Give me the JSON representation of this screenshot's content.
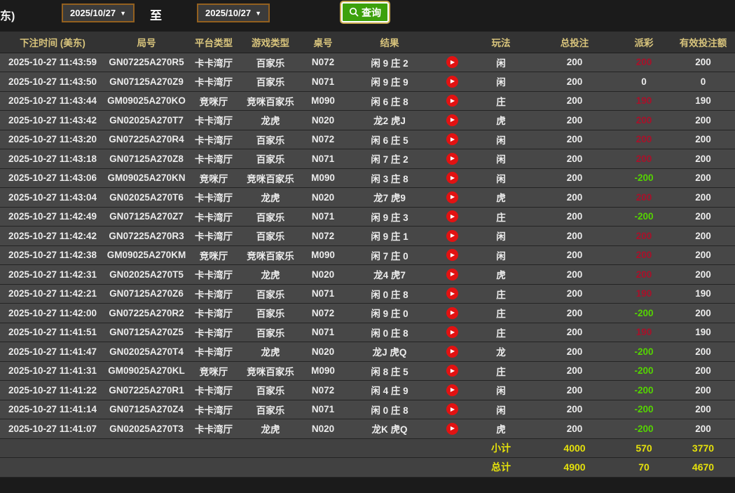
{
  "topbar": {
    "clipped_label": "东)",
    "date_from": "2025/10/27",
    "to_label": "至",
    "date_to": "2025/10/27",
    "query_label": "查询"
  },
  "icons": {
    "caret": "▼",
    "play": "▶"
  },
  "colors": {
    "header_text": "#d8c47c",
    "payout_win": "#a8112a",
    "payout_loss": "#55d400",
    "summary_text": "#e5e10b",
    "query_button_bg": "#3da10c",
    "date_border": "#93601f",
    "play_icon_bg": "#e21212"
  },
  "table": {
    "columns": [
      "下注时间 (美东)",
      "局号",
      "平台类型",
      "游戏类型",
      "桌号",
      "结果",
      "",
      "玩法",
      "总投注",
      "派彩",
      "有效投注额"
    ],
    "rows": [
      {
        "time": "2025-10-27 11:43:59",
        "round": "GN07225A270R5",
        "platform": "卡卡湾厅",
        "game": "百家乐",
        "table_no": "N072",
        "result": "闲 9 庄 2",
        "bet_type": "闲",
        "total_bet": "200",
        "payout": "200",
        "valid_bet": "200"
      },
      {
        "time": "2025-10-27 11:43:50",
        "round": "GN07125A270Z9",
        "platform": "卡卡湾厅",
        "game": "百家乐",
        "table_no": "N071",
        "result": "闲 9 庄 9",
        "bet_type": "闲",
        "total_bet": "200",
        "payout": "0",
        "valid_bet": "0"
      },
      {
        "time": "2025-10-27 11:43:44",
        "round": "GM09025A270KO",
        "platform": "竞咪厅",
        "game": "竞咪百家乐",
        "table_no": "M090",
        "result": "闲 6 庄 8",
        "bet_type": "庄",
        "total_bet": "200",
        "payout": "190",
        "valid_bet": "190"
      },
      {
        "time": "2025-10-27 11:43:42",
        "round": "GN02025A270T7",
        "platform": "卡卡湾厅",
        "game": "龙虎",
        "table_no": "N020",
        "result": "龙2 虎J",
        "bet_type": "虎",
        "total_bet": "200",
        "payout": "200",
        "valid_bet": "200"
      },
      {
        "time": "2025-10-27 11:43:20",
        "round": "GN07225A270R4",
        "platform": "卡卡湾厅",
        "game": "百家乐",
        "table_no": "N072",
        "result": "闲 6 庄 5",
        "bet_type": "闲",
        "total_bet": "200",
        "payout": "200",
        "valid_bet": "200"
      },
      {
        "time": "2025-10-27 11:43:18",
        "round": "GN07125A270Z8",
        "platform": "卡卡湾厅",
        "game": "百家乐",
        "table_no": "N071",
        "result": "闲 7 庄 2",
        "bet_type": "闲",
        "total_bet": "200",
        "payout": "200",
        "valid_bet": "200"
      },
      {
        "time": "2025-10-27 11:43:06",
        "round": "GM09025A270KN",
        "platform": "竞咪厅",
        "game": "竞咪百家乐",
        "table_no": "M090",
        "result": "闲 3 庄 8",
        "bet_type": "闲",
        "total_bet": "200",
        "payout": "-200",
        "valid_bet": "200"
      },
      {
        "time": "2025-10-27 11:43:04",
        "round": "GN02025A270T6",
        "platform": "卡卡湾厅",
        "game": "龙虎",
        "table_no": "N020",
        "result": "龙7 虎9",
        "bet_type": "虎",
        "total_bet": "200",
        "payout": "200",
        "valid_bet": "200"
      },
      {
        "time": "2025-10-27 11:42:49",
        "round": "GN07125A270Z7",
        "platform": "卡卡湾厅",
        "game": "百家乐",
        "table_no": "N071",
        "result": "闲 9 庄 3",
        "bet_type": "庄",
        "total_bet": "200",
        "payout": "-200",
        "valid_bet": "200"
      },
      {
        "time": "2025-10-27 11:42:42",
        "round": "GN07225A270R3",
        "platform": "卡卡湾厅",
        "game": "百家乐",
        "table_no": "N072",
        "result": "闲 9 庄 1",
        "bet_type": "闲",
        "total_bet": "200",
        "payout": "200",
        "valid_bet": "200"
      },
      {
        "time": "2025-10-27 11:42:38",
        "round": "GM09025A270KM",
        "platform": "竞咪厅",
        "game": "竞咪百家乐",
        "table_no": "M090",
        "result": "闲 7 庄 0",
        "bet_type": "闲",
        "total_bet": "200",
        "payout": "200",
        "valid_bet": "200"
      },
      {
        "time": "2025-10-27 11:42:31",
        "round": "GN02025A270T5",
        "platform": "卡卡湾厅",
        "game": "龙虎",
        "table_no": "N020",
        "result": "龙4 虎7",
        "bet_type": "虎",
        "total_bet": "200",
        "payout": "200",
        "valid_bet": "200"
      },
      {
        "time": "2025-10-27 11:42:21",
        "round": "GN07125A270Z6",
        "platform": "卡卡湾厅",
        "game": "百家乐",
        "table_no": "N071",
        "result": "闲 0 庄 8",
        "bet_type": "庄",
        "total_bet": "200",
        "payout": "190",
        "valid_bet": "190"
      },
      {
        "time": "2025-10-27 11:42:00",
        "round": "GN07225A270R2",
        "platform": "卡卡湾厅",
        "game": "百家乐",
        "table_no": "N072",
        "result": "闲 9 庄 0",
        "bet_type": "庄",
        "total_bet": "200",
        "payout": "-200",
        "valid_bet": "200"
      },
      {
        "time": "2025-10-27 11:41:51",
        "round": "GN07125A270Z5",
        "platform": "卡卡湾厅",
        "game": "百家乐",
        "table_no": "N071",
        "result": "闲 0 庄 8",
        "bet_type": "庄",
        "total_bet": "200",
        "payout": "190",
        "valid_bet": "190"
      },
      {
        "time": "2025-10-27 11:41:47",
        "round": "GN02025A270T4",
        "platform": "卡卡湾厅",
        "game": "龙虎",
        "table_no": "N020",
        "result": "龙J 虎Q",
        "bet_type": "龙",
        "total_bet": "200",
        "payout": "-200",
        "valid_bet": "200"
      },
      {
        "time": "2025-10-27 11:41:31",
        "round": "GM09025A270KL",
        "platform": "竞咪厅",
        "game": "竞咪百家乐",
        "table_no": "M090",
        "result": "闲 8 庄 5",
        "bet_type": "庄",
        "total_bet": "200",
        "payout": "-200",
        "valid_bet": "200"
      },
      {
        "time": "2025-10-27 11:41:22",
        "round": "GN07225A270R1",
        "platform": "卡卡湾厅",
        "game": "百家乐",
        "table_no": "N072",
        "result": "闲 4 庄 9",
        "bet_type": "闲",
        "total_bet": "200",
        "payout": "-200",
        "valid_bet": "200"
      },
      {
        "time": "2025-10-27 11:41:14",
        "round": "GN07125A270Z4",
        "platform": "卡卡湾厅",
        "game": "百家乐",
        "table_no": "N071",
        "result": "闲 0 庄 8",
        "bet_type": "闲",
        "total_bet": "200",
        "payout": "-200",
        "valid_bet": "200"
      },
      {
        "time": "2025-10-27 11:41:07",
        "round": "GN02025A270T3",
        "platform": "卡卡湾厅",
        "game": "龙虎",
        "table_no": "N020",
        "result": "龙K 虎Q",
        "bet_type": "虎",
        "total_bet": "200",
        "payout": "-200",
        "valid_bet": "200"
      }
    ],
    "summary": [
      {
        "label": "小计",
        "total_bet": "4000",
        "payout": "570",
        "valid_bet": "3770"
      },
      {
        "label": "总计",
        "total_bet": "4900",
        "payout": "70",
        "valid_bet": "4670"
      }
    ]
  }
}
